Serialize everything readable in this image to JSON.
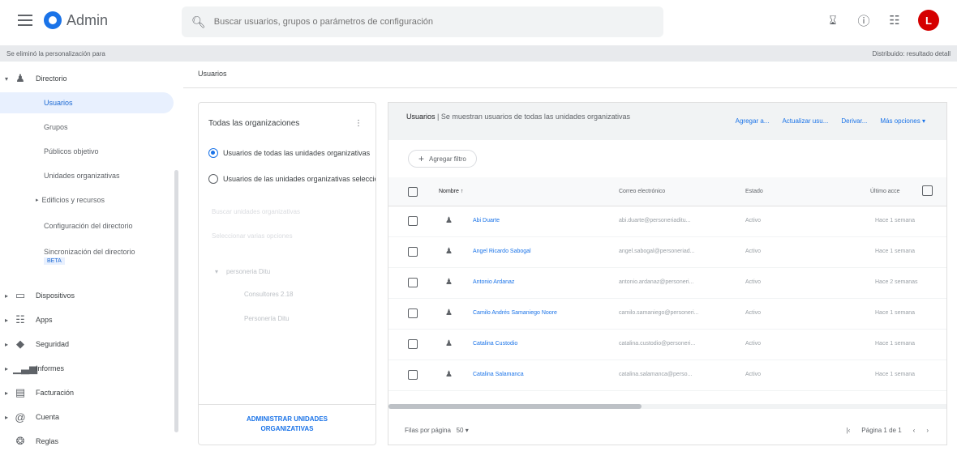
{
  "app": {
    "title": "Admin"
  },
  "search": {
    "placeholder": "Buscar usuarios, grupos o parámetros de configuración"
  },
  "topbar": {
    "avatar_letter": "L",
    "icons": [
      "hourglass-icon",
      "help-icon",
      "apps-icon"
    ]
  },
  "notice": {
    "left": "Se eliminó la personalización para",
    "right": "Distribuido: resultado detall"
  },
  "sidebar": {
    "directory_label": "Directorio",
    "sub_items": [
      {
        "label": "Usuarios"
      },
      {
        "label": "Grupos"
      },
      {
        "label": "Públicos objetivo"
      },
      {
        "label": "Unidades organizativas"
      },
      {
        "label": "Edificios y recursos"
      },
      {
        "label": "Configuración del directorio"
      },
      {
        "label": "Sincronización del directorio"
      }
    ],
    "beta_badge": "BETA",
    "sections": [
      {
        "label": "Dispositivos",
        "icon": "devices-icon"
      },
      {
        "label": "Apps",
        "icon": "apps-icon"
      },
      {
        "label": "Seguridad",
        "icon": "security-shield-icon"
      },
      {
        "label": "Informes",
        "icon": "reports-chart-icon"
      },
      {
        "label": "Facturación",
        "icon": "billing-card-icon"
      },
      {
        "label": "Cuenta",
        "icon": "account-at-icon"
      },
      {
        "label": "Reglas",
        "icon": "rules-icon"
      }
    ]
  },
  "breadcrumb": "Usuarios",
  "org_panel": {
    "title": "Todas las organizaciones",
    "radio_all": "Usuarios de todas las unidades organizativas",
    "radio_selected": "Usuarios de las unidades organizativas seleccionadas",
    "faint_1": "Buscar unidades organizativas",
    "faint_2": "Seleccionar varias opciones",
    "tree_root": "personeria Ditu",
    "tree_child_1": "Consultores 2.18",
    "tree_child_2": "Personería Ditu",
    "manage_line1": "ADMINISTRAR UNIDADES",
    "manage_line2": "ORGANIZATIVAS"
  },
  "users_panel": {
    "title_bold": "Usuarios",
    "title_rest": " | Se muestran usuarios de todas las unidades organizativas",
    "actions": [
      "Agregar a...",
      "Actualizar usu...",
      "Derivar...",
      "Más opciones"
    ],
    "add_filter": "Agregar filtro",
    "columns": {
      "name": "Nombre ↑",
      "email": "Correo electrónico",
      "status": "Estado",
      "last_login": "Último acce"
    },
    "rows": [
      {
        "name": "Abi Duarte",
        "email": "abi.duarte@personeriaditu...",
        "status": "Activo",
        "last": "Hace 1 semana"
      },
      {
        "name": "Angel Ricardo Sabogal",
        "email": "angel.sabogal@personeriad...",
        "status": "Activo",
        "last": "Hace 1 semana"
      },
      {
        "name": "Antonio Ardanaz",
        "email": "antonio.ardanaz@personeri...",
        "status": "Activo",
        "last": "Hace 2 semanas"
      },
      {
        "name": "Camilo Andrés Samaniego Noore",
        "email": "camilo.samaniego@personeri...",
        "status": "Activo",
        "last": "Hace 1 semana"
      },
      {
        "name": "Catalina Custodio",
        "email": "catalina.custodio@personeri...",
        "status": "Activo",
        "last": "Hace 1 semana"
      },
      {
        "name": "Catalina Salamanca",
        "email": "catalina.salamanca@perso...",
        "status": "Activo",
        "last": "Hace 1 semana"
      }
    ],
    "rows_per_page_label": "Filas por página",
    "rows_per_page_value": "50 ▾",
    "page_label": "Página 1 de 1"
  }
}
